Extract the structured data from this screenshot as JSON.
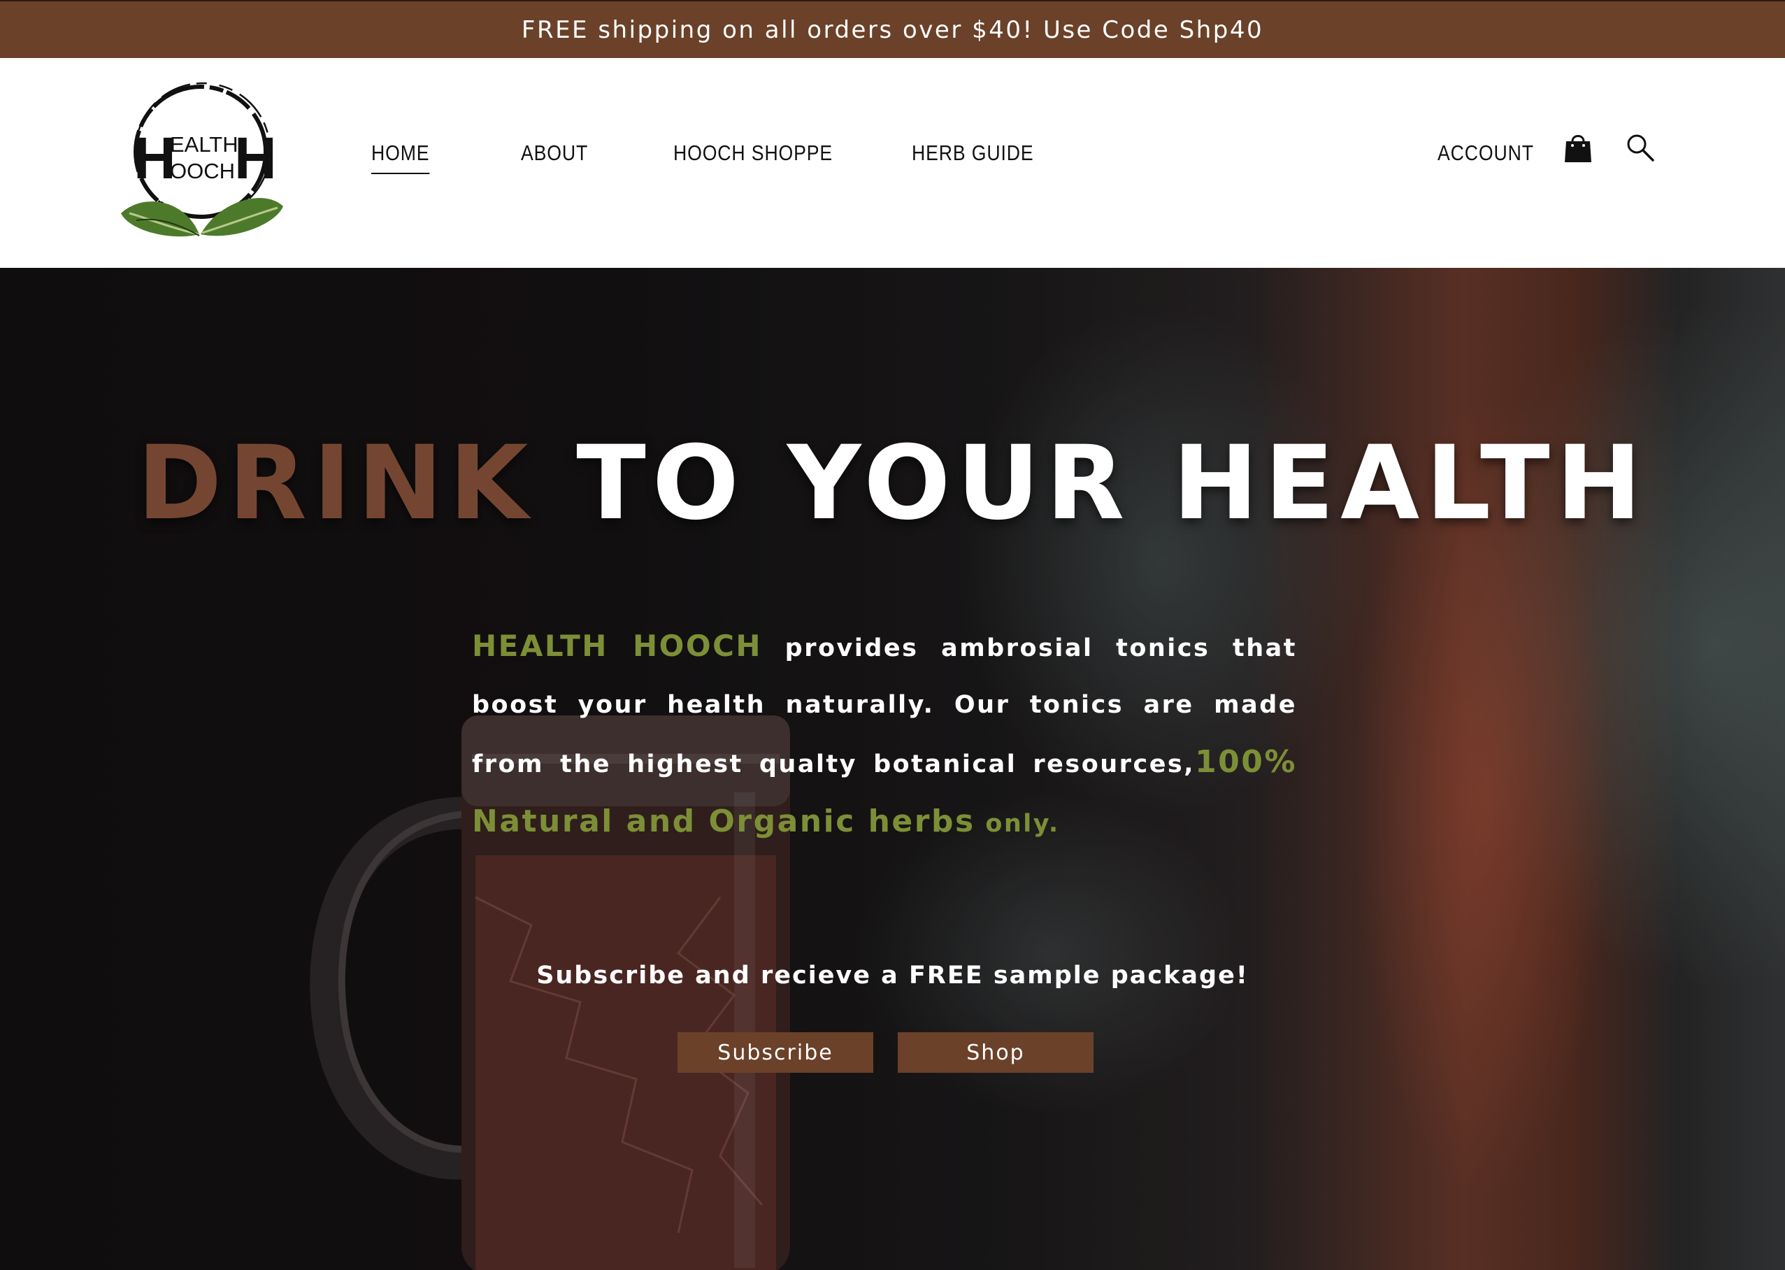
{
  "promo": {
    "text": "FREE shipping on all orders over $40! Use Code Shp40"
  },
  "logo": {
    "line1": "EALTH",
    "line2": "OOCH",
    "left_letter": "H",
    "right_letter": "H"
  },
  "nav": {
    "items": [
      {
        "label": "HOME",
        "active": true
      },
      {
        "label": "ABOUT"
      },
      {
        "label": "HOOCH SHOPPE"
      },
      {
        "label": "HERB GUIDE"
      }
    ],
    "account_label": "ACCOUNT",
    "icons": [
      "shopping-bag-icon",
      "search-icon"
    ]
  },
  "hero": {
    "title_accent": "DRINK",
    "title_rest": " TO YOUR HEALTH",
    "body": {
      "brand": "HEALTH HOOCH",
      "text1": " provides ambrosial tonics that boost your health naturally. Our tonics are made from the highest qualty botanical resources,",
      "green": "100% Natural and Organic herbs",
      "text2": " only."
    },
    "subscribe_text": "Subscribe and recieve a FREE sample package!",
    "buttons": {
      "subscribe": "Subscribe",
      "shop": "Shop"
    }
  },
  "colors": {
    "brand_brown": "#6b4129",
    "accent_brown": "#744631",
    "herb_green": "#7d8f36"
  }
}
